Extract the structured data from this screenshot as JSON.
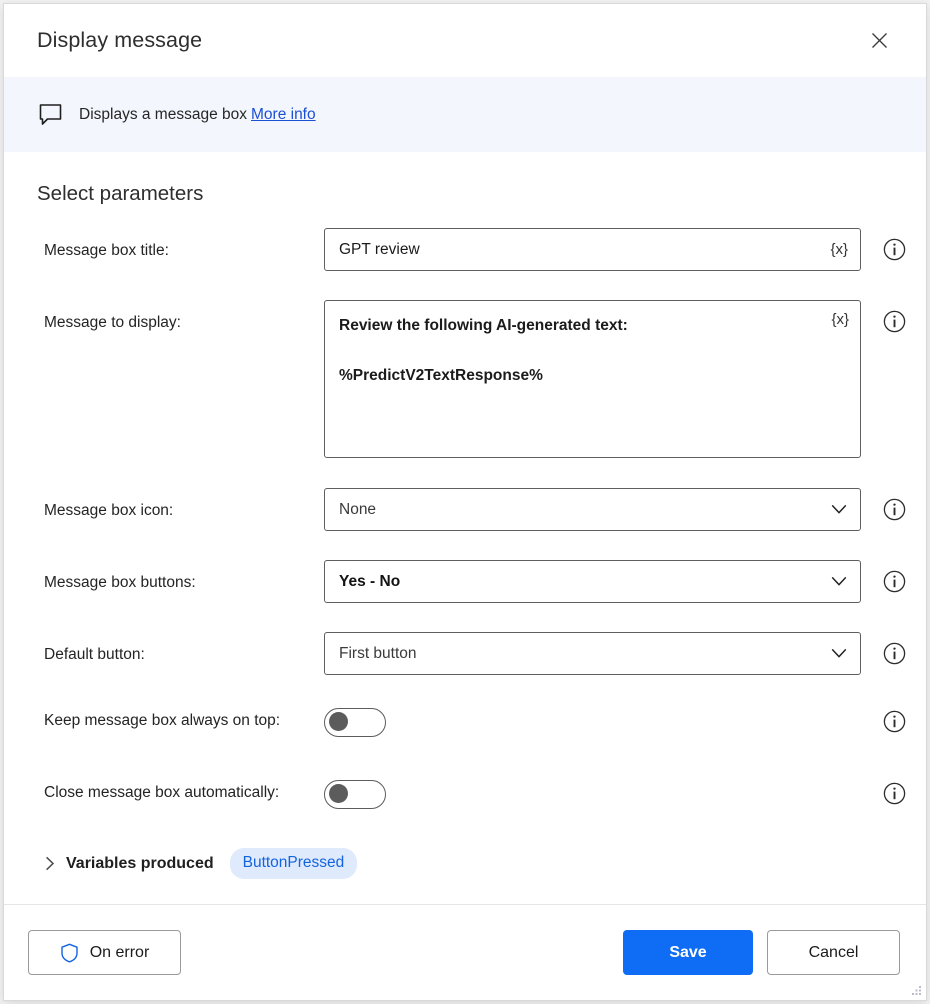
{
  "window": {
    "title": "Display message",
    "close_label": "Close"
  },
  "banner": {
    "icon": "message-box-icon",
    "text": "Displays a message box",
    "link_label": "More info"
  },
  "main": {
    "section_title": "Select parameters",
    "fields": [
      {
        "label": "Message box title:",
        "type": "text",
        "value": "GPT review",
        "variable_button": "{x}",
        "info": "i"
      },
      {
        "label": "Message to display:",
        "type": "textarea",
        "value": "Review the following AI-generated text:\n\n%PredictV2TextResponse%",
        "variable_button": "{x}",
        "info": "i"
      },
      {
        "label": "Message box icon:",
        "type": "dropdown",
        "value": "None",
        "info": "i"
      },
      {
        "label": "Message box buttons:",
        "type": "dropdown",
        "value": "Yes - No",
        "info": "i"
      },
      {
        "label": "Default button:",
        "type": "dropdown",
        "value": "First button",
        "info": "i"
      },
      {
        "label": "Keep message box always on top:",
        "type": "toggle",
        "value": "off",
        "info": "i"
      },
      {
        "label": "Close message box automatically:",
        "type": "toggle",
        "value": "off",
        "info": "i"
      }
    ],
    "variables_produced": {
      "title": "Variables produced",
      "expanded": false,
      "items": [
        "ButtonPressed"
      ]
    }
  },
  "footer": {
    "on_error_label": "On error",
    "save_label": "Save",
    "cancel_label": "Cancel"
  },
  "colors": {
    "accent": "#0f6cf5",
    "link": "#1b4fd4",
    "banner_bg": "#f3f7fd",
    "pill_bg": "#dfeafc",
    "pill_text": "#1464e0",
    "field_border": "#605e5c"
  }
}
